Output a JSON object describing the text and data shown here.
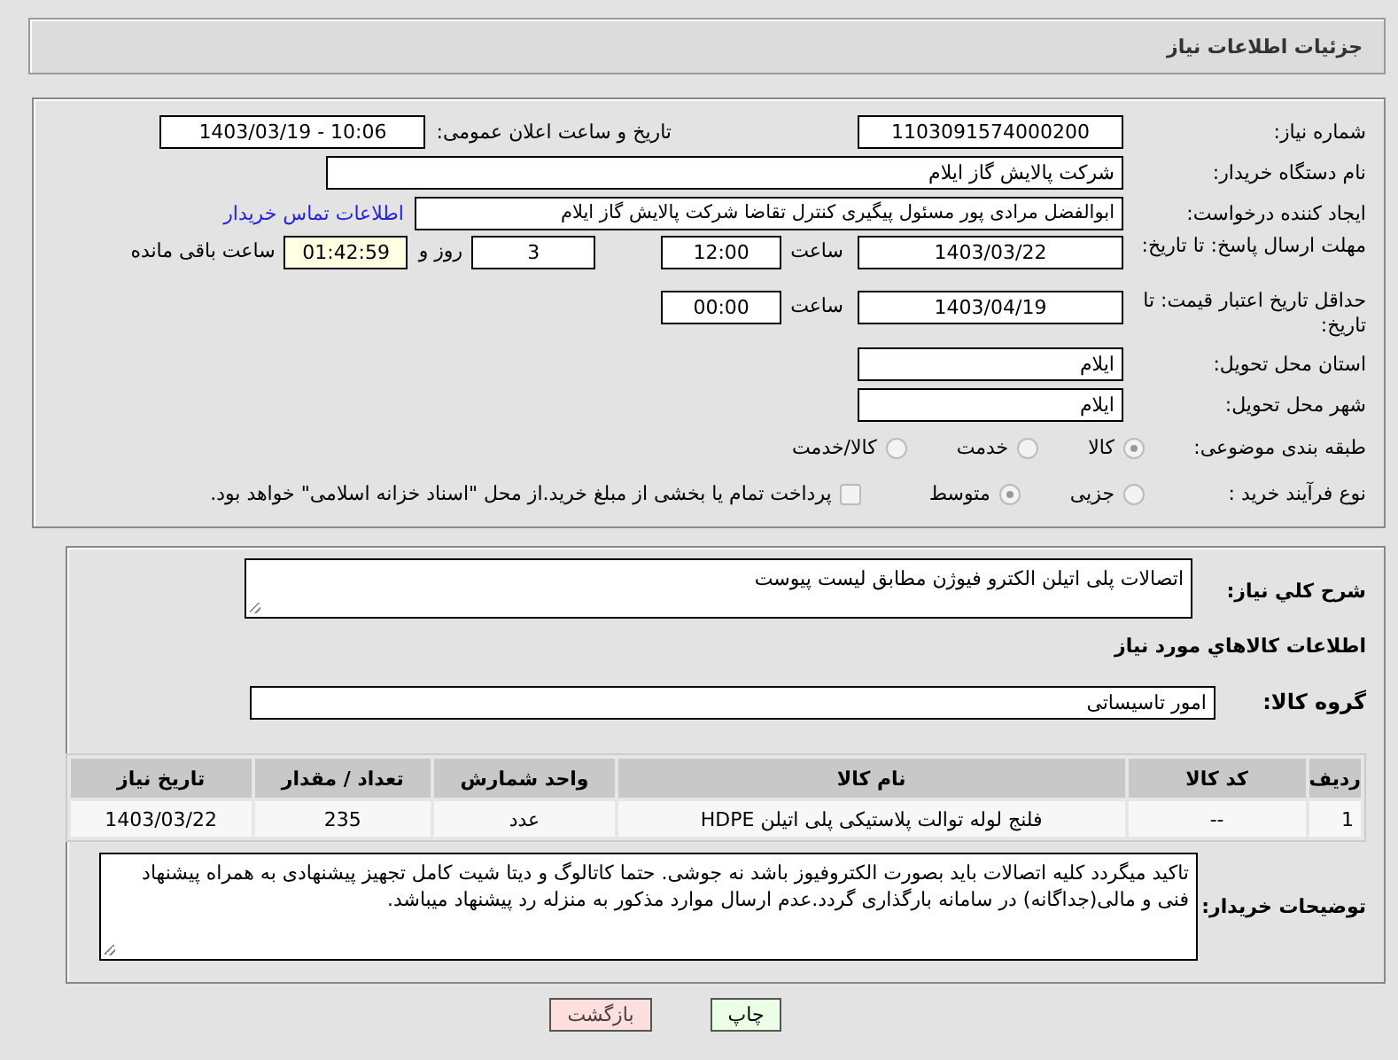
{
  "header": {
    "title": "جزئیات اطلاعات نیاز"
  },
  "need_number": {
    "label": "شماره نیاز:",
    "value": "1103091574000200"
  },
  "announce": {
    "label": "تاریخ و ساعت اعلان عمومی:",
    "value": "1403/03/19 - 10:06"
  },
  "buyer": {
    "label": "نام دستگاه خریدار:",
    "value": "شرکت پالایش گاز ایلام"
  },
  "requester": {
    "label": "ایجاد کننده درخواست:",
    "value": "ابوالفضل مرادی پور مسئول پیگیری کنترل تقاضا شرکت پالایش گاز ایلام",
    "link": "اطلاعات تماس خریدار"
  },
  "deadline": {
    "label": "مهلت ارسال پاسخ: تا تاریخ:",
    "date": "1403/03/22",
    "time_label": "ساعت",
    "time": "12:00",
    "days": "3",
    "days_label": "روز و",
    "remaining": "01:42:59",
    "remaining_label": "ساعت باقی مانده"
  },
  "validity": {
    "label": "حداقل تاریخ اعتبار قیمت: تا تاریخ:",
    "date": "1403/04/19",
    "time_label": "ساعت",
    "time": "00:00"
  },
  "province": {
    "label": "استان محل تحویل:",
    "value": "ایلام"
  },
  "city": {
    "label": "شهر محل تحویل:",
    "value": "ایلام"
  },
  "category": {
    "label": "طبقه بندی موضوعی:",
    "options": [
      {
        "label": "کالا",
        "selected": true
      },
      {
        "label": "خدمت",
        "selected": false
      },
      {
        "label": "کالا/خدمت",
        "selected": false
      }
    ]
  },
  "process": {
    "label": "نوع فرآیند خرید :",
    "options": [
      {
        "label": "جزیی",
        "selected": false
      },
      {
        "label": "متوسط",
        "selected": true
      }
    ],
    "payment": {
      "label": "پرداخت تمام یا بخشی از مبلغ خرید.از محل \"اسناد خزانه اسلامی\" خواهد بود.",
      "checked": false
    }
  },
  "description": {
    "label": "شرح کلي نیاز:",
    "value": "اتصالات پلی اتیلن الکترو فیوژن مطابق لیست پیوست"
  },
  "goods_title": "اطلاعات كالاهاي مورد نياز",
  "goods_group": {
    "label": "گروه کالا:",
    "value": "امور تاسیساتی"
  },
  "table": {
    "columns": [
      "ردیف",
      "کد کالا",
      "نام کالا",
      "واحد شمارش",
      "تعداد / مقدار",
      "تاریخ نیاز"
    ],
    "rows": [
      [
        "1",
        "--",
        "فلنج لوله توالت پلاستیکی پلی اتیلن HDPE",
        "عدد",
        "235",
        "1403/03/22"
      ]
    ]
  },
  "notes": {
    "label": "توضیحات خریدار:",
    "value": "تاکید میگردد کلیه اتصالات باید بصورت الکتروفیوز باشد نه جوشی. حتما کاتالوگ و دیتا شیت کامل تجهیز پیشنهادی به همراه پیشنهاد فنی و مالی(جداگانه) در سامانه بارگذاری گردد.عدم ارسال موارد مذکور به منزله رد پیشنهاد میباشد."
  },
  "buttons": [
    {
      "kind": "print",
      "label": "چاپ"
    },
    {
      "kind": "back",
      "label": "بازگشت"
    }
  ]
}
